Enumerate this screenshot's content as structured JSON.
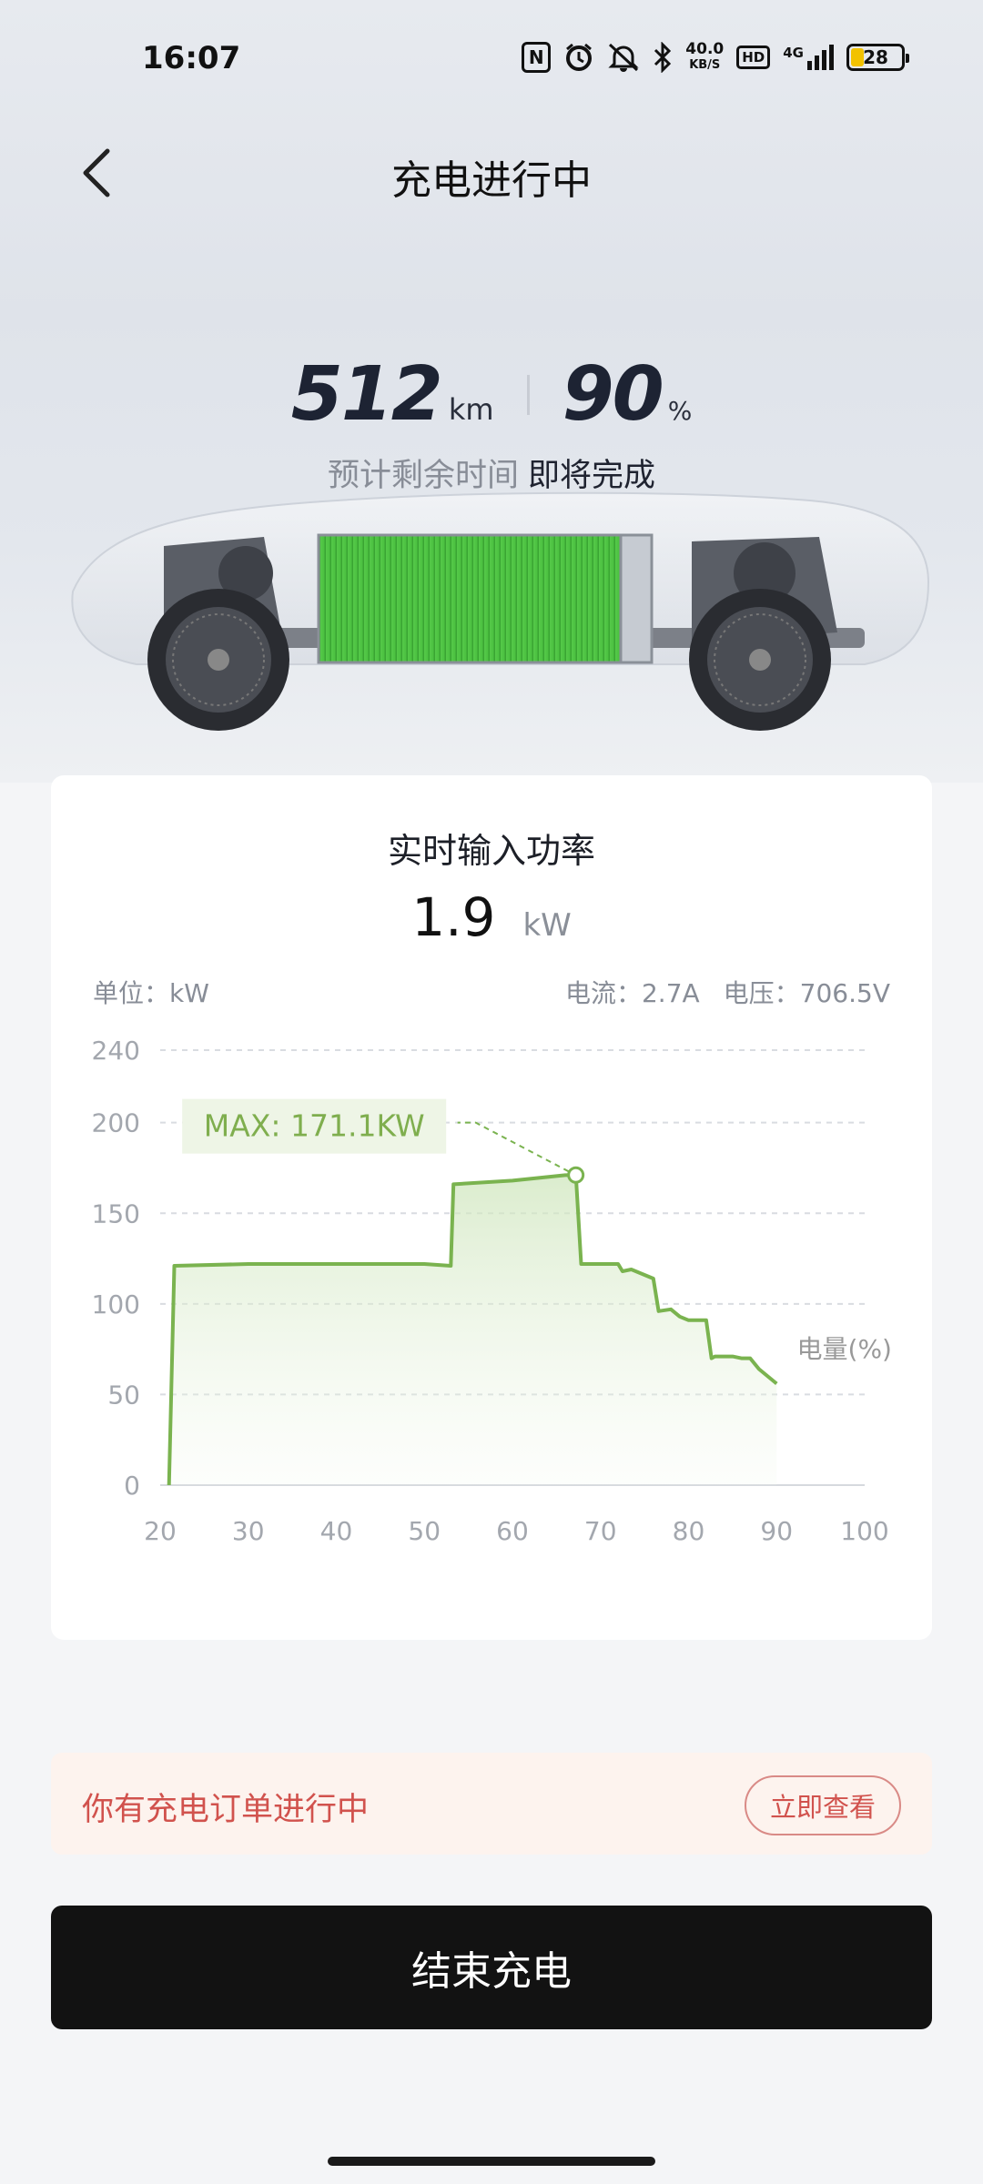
{
  "status_bar": {
    "time": "16:07",
    "nfc": "N",
    "net_speed_value": "40.0",
    "net_speed_unit": "KB/S",
    "hd": "HD",
    "network": "4G",
    "battery": "28",
    "icons": [
      "nfc-icon",
      "alarm-icon",
      "mute-icon",
      "bluetooth-icon",
      "signal-icon",
      "battery-icon"
    ]
  },
  "header": {
    "title": "充电进行中",
    "back_icon": "chevron-left-icon"
  },
  "stats": {
    "range_value": "512",
    "range_unit": "km",
    "soc_value": "90",
    "soc_unit": "%",
    "remaining_label": "预计剩余时间",
    "remaining_value": "即将完成"
  },
  "power_card": {
    "title": "实时输入功率",
    "power_value": "1.9",
    "power_unit": "kW",
    "unit_label": "单位：kW",
    "current": "电流：2.7A",
    "voltage": "电压：706.5V",
    "max_label": "MAX: 171.1KW"
  },
  "chart_data": {
    "type": "area",
    "xlabel": "电量(%)",
    "ylabel": "",
    "xlim": [
      20,
      100
    ],
    "ylim": [
      0,
      240
    ],
    "x_ticks": [
      20,
      30,
      40,
      50,
      60,
      70,
      80,
      90,
      100
    ],
    "y_ticks": [
      0,
      50,
      100,
      150,
      200,
      240
    ],
    "grid": true,
    "series": [
      {
        "x": [
          21,
          21.6,
          30,
          40,
          50,
          53,
          53.3,
          60,
          66,
          67.2,
          67.8,
          70,
          72,
          72.5,
          73.5,
          75,
          76,
          76.6,
          78,
          79,
          80,
          81,
          82,
          82.6,
          83,
          85,
          86,
          87,
          88,
          89,
          90
        ],
        "y": [
          0,
          121,
          122,
          122,
          122,
          121,
          166,
          168,
          171,
          171.1,
          122,
          122,
          122,
          118,
          119,
          116,
          114,
          96,
          97,
          93,
          91,
          91,
          91,
          70,
          71,
          71,
          70,
          70,
          64,
          60,
          56
        ]
      }
    ],
    "annotations": [
      {
        "text": "MAX: 171.1KW",
        "x": 67.2,
        "y": 171.1
      }
    ],
    "colors": {
      "line": "#7ab34f",
      "label_bg": "#eef5e6",
      "label_text": "#7fae4e"
    }
  },
  "order_banner": {
    "text": "你有充电订单进行中",
    "button": "立即查看"
  },
  "end_button": {
    "label": "结束充电"
  }
}
